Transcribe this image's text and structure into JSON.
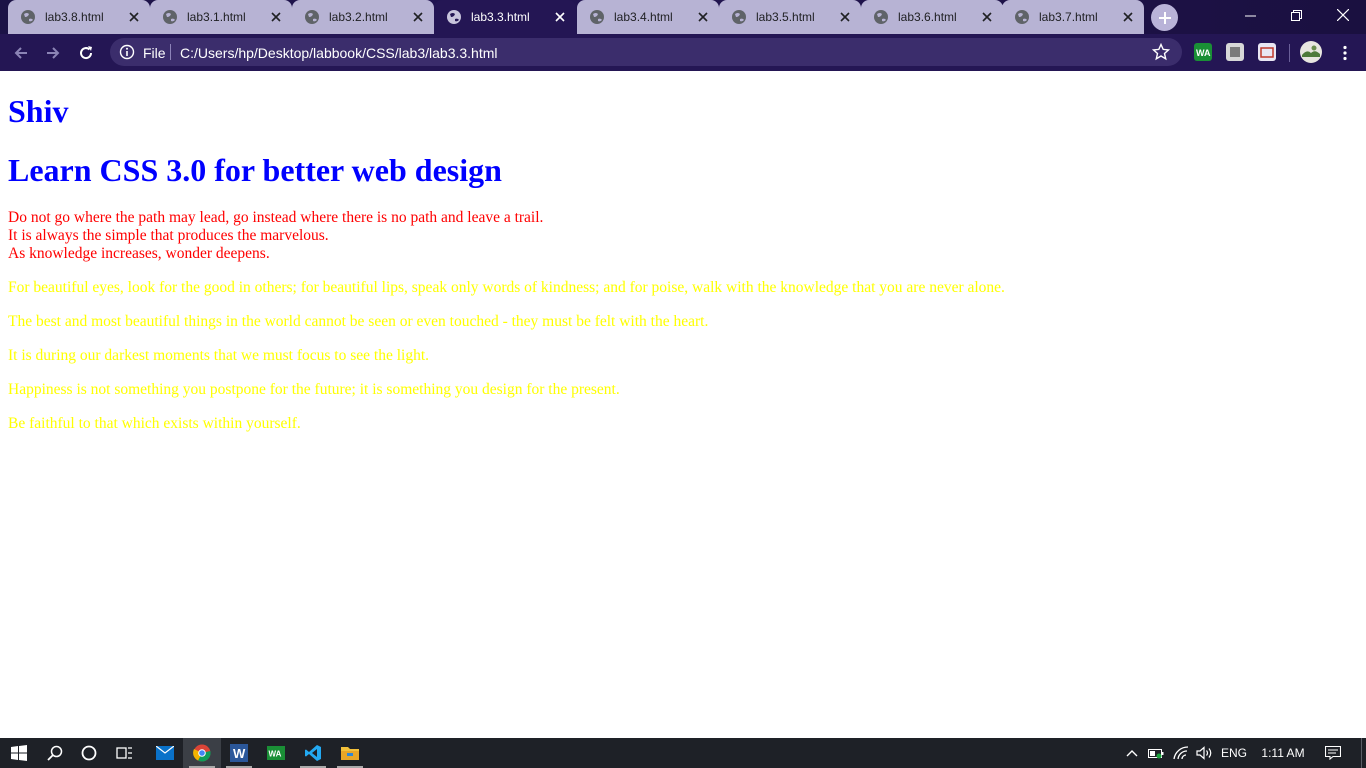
{
  "browser": {
    "tabs": [
      {
        "title": "lab3.8.html"
      },
      {
        "title": "lab3.1.html"
      },
      {
        "title": "lab3.2.html"
      },
      {
        "title": "lab3.3.html",
        "active": true
      },
      {
        "title": "lab3.4.html"
      },
      {
        "title": "lab3.5.html"
      },
      {
        "title": "lab3.6.html"
      },
      {
        "title": "lab3.7.html"
      }
    ],
    "omnibox": {
      "scheme": "File",
      "url": "C:/Users/hp/Desktop/labbook/CSS/lab3/lab3.3.html"
    },
    "colors": {
      "frame": "#241654",
      "inactive_tab": "#b7b3d4"
    }
  },
  "page": {
    "heading1": "Shiv",
    "heading2": "Learn CSS 3.0 for better web design",
    "red_lines": [
      "Do not go where the path may lead, go instead where there is no path and leave a trail.",
      "It is always the simple that produces the marvelous.",
      "As knowledge increases, wonder deepens."
    ],
    "yellow_paragraphs": [
      "For beautiful eyes, look for the good in others; for beautiful lips, speak only words of kindness; and for poise, walk with the knowledge that you are never alone.",
      "The best and most beautiful things in the world cannot be seen or even touched - they must be felt with the heart.",
      "It is during our darkest moments that we must focus to see the light.",
      "Happiness is not something you postpone for the future; it is something you design for the present.",
      "Be faithful to that which exists within yourself."
    ],
    "colors": {
      "heading": "#0000ff",
      "red_text": "#ff0000",
      "yellow_text": "#ffff00"
    }
  },
  "taskbar": {
    "apps": [
      "start-icon",
      "search-icon",
      "cortana-icon",
      "task-view-icon",
      "mail-icon",
      "chrome-icon",
      "word-icon",
      "whatsapp-icon",
      "vscode-icon",
      "file-explorer-icon"
    ],
    "language": "ENG",
    "time": "1:11 AM"
  }
}
